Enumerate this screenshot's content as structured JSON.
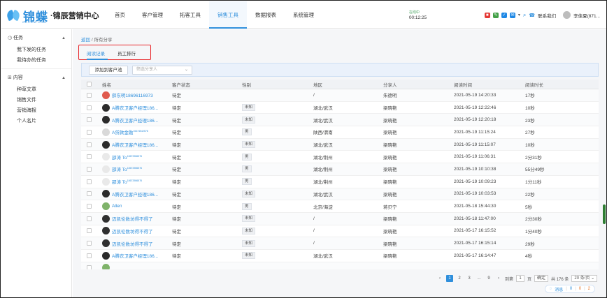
{
  "brand": {
    "logo_text": "锦蝶",
    "logo_sub": "GDCRM.COM",
    "name": "·锦辰营销中心"
  },
  "nav": [
    {
      "label": "首页"
    },
    {
      "label": "客户管理"
    },
    {
      "label": "拓客工具"
    },
    {
      "label": "销售工具",
      "active": true
    },
    {
      "label": "数据报表"
    },
    {
      "label": "系统管理"
    }
  ],
  "header": {
    "clock_label": "在线中",
    "clock_time": "00:12:25",
    "contact": "联系我们",
    "user": "李佳夏(871...",
    "icon_colors": [
      "#e53935",
      "#43a047",
      "#1e88e5",
      "#1e88e5"
    ]
  },
  "sidebar": {
    "sections": [
      {
        "title": "任务",
        "icon": "clock-icon",
        "items": [
          "我下发的任务",
          "我待办的任务"
        ]
      },
      {
        "title": "内容",
        "icon": "content-icon",
        "items": [
          "种草文章",
          "销售文件",
          "营销海报",
          "个人名片"
        ]
      }
    ]
  },
  "breadcrumb": {
    "back": "返回",
    "sep": "/",
    "current": "所有分享"
  },
  "tabs": [
    {
      "label": "阅读记录",
      "active": true
    },
    {
      "label": "员工排行"
    }
  ],
  "filter": {
    "add_button": "添加到客户池",
    "share_placeholder": "筛选分享人"
  },
  "table": {
    "columns": [
      "姓名",
      "客户状态",
      "性别",
      "地区",
      "分享人",
      "阅读时间",
      "阅读时长"
    ],
    "rows": [
      {
        "name": "薛东明18696116973",
        "status": "待定",
        "gender": "",
        "region": "/",
        "sharer": "朱德明",
        "time": "2021-05-19 14:20:33",
        "duration": "17秒",
        "avatar": "red"
      },
      {
        "name": "A腾衣卫客户经理186...",
        "status": "待定",
        "gender": "未知",
        "region": "湖北/武汉",
        "sharer": "梁晓艳",
        "time": "2021-05-19 12:22:46",
        "duration": "10秒",
        "avatar": "dark"
      },
      {
        "name": "A腾衣卫客户经理186...",
        "status": "待定",
        "gender": "未知",
        "region": "湖北/武汉",
        "sharer": "梁晓艳",
        "time": "2021-05-19 12:20:18",
        "duration": "23秒",
        "avatar": "dark"
      },
      {
        "name": "A贷款金融",
        "name_sup": "15474542578",
        "status": "待定",
        "gender": "男",
        "region": "陕西/渭南",
        "sharer": "梁晓艳",
        "time": "2021-05-19 11:15:24",
        "duration": "27秒",
        "avatar": "person"
      },
      {
        "name": "A腾衣卫客户经理186...",
        "status": "待定",
        "gender": "未知",
        "region": "湖北/武汉",
        "sharer": "梁晓艳",
        "time": "2021-05-19 11:15:07",
        "duration": "10秒",
        "avatar": "dark"
      },
      {
        "name": "邵涛 To",
        "name_sup": "18672986576",
        "status": "待定",
        "gender": "男",
        "region": "湖北/荆州",
        "sharer": "梁晓艳",
        "time": "2021-05-19 11:06:31",
        "duration": "2分31秒",
        "avatar": "white"
      },
      {
        "name": "邵涛 To",
        "name_sup": "18672986576",
        "status": "待定",
        "gender": "男",
        "region": "湖北/荆州",
        "sharer": "梁晓艳",
        "time": "2021-05-19 10:10:38",
        "duration": "55分49秒",
        "avatar": "white"
      },
      {
        "name": "邵涛 To",
        "name_sup": "18672986576",
        "status": "待定",
        "gender": "男",
        "region": "湖北/荆州",
        "sharer": "梁晓艳",
        "time": "2021-05-19 10:09:23",
        "duration": "1分11秒",
        "avatar": "white"
      },
      {
        "name": "A腾衣卫客户经理186...",
        "status": "待定",
        "gender": "未知",
        "region": "湖北/武汉",
        "sharer": "梁晓艳",
        "time": "2021-05-19 10:03:53",
        "duration": "22秒",
        "avatar": "dark"
      },
      {
        "name": "Allen",
        "status": "待定",
        "gender": "男",
        "region": "北京/海淀",
        "sharer": "蒋贝宁",
        "time": "2021-05-18 15:44:30",
        "duration": "5秒",
        "avatar": "green"
      },
      {
        "name": "迈凯伦数坊得不得了",
        "status": "待定",
        "gender": "未知",
        "region": "/",
        "sharer": "梁晓艳",
        "time": "2021-05-18 11:47:00",
        "duration": "2分30秒",
        "avatar": "yellow"
      },
      {
        "name": "迈凯伦数坊得不得了",
        "status": "待定",
        "gender": "未知",
        "region": "/",
        "sharer": "梁晓艳",
        "time": "2021-05-17 16:15:52",
        "duration": "1分40秒",
        "avatar": "yellow"
      },
      {
        "name": "迈凯伦数坊得不得了",
        "status": "待定",
        "gender": "未知",
        "region": "/",
        "sharer": "梁晓艳",
        "time": "2021-05-17 16:15:14",
        "duration": "29秒",
        "avatar": "yellow"
      },
      {
        "name": "A腾衣卫客户经理186...",
        "status": "待定",
        "gender": "未知",
        "region": "湖北/武汉",
        "sharer": "梁晓艳",
        "time": "2021-05-17 16:14:47",
        "duration": "4秒",
        "avatar": "dark"
      },
      {
        "name": "",
        "status": "",
        "gender": "",
        "region": "",
        "sharer": "",
        "time": "",
        "duration": "",
        "avatar": "green"
      }
    ]
  },
  "pager": {
    "prev": "‹",
    "pages": [
      "1",
      "2",
      "3",
      "...",
      "9"
    ],
    "next": "›",
    "goto": "到第",
    "goto_value": "1",
    "page_unit": "页",
    "confirm": "确定",
    "total": "共 176 条",
    "page_size": "20 条/页"
  },
  "message": {
    "label": "消息",
    "counts": [
      "0",
      "0",
      "2"
    ]
  }
}
